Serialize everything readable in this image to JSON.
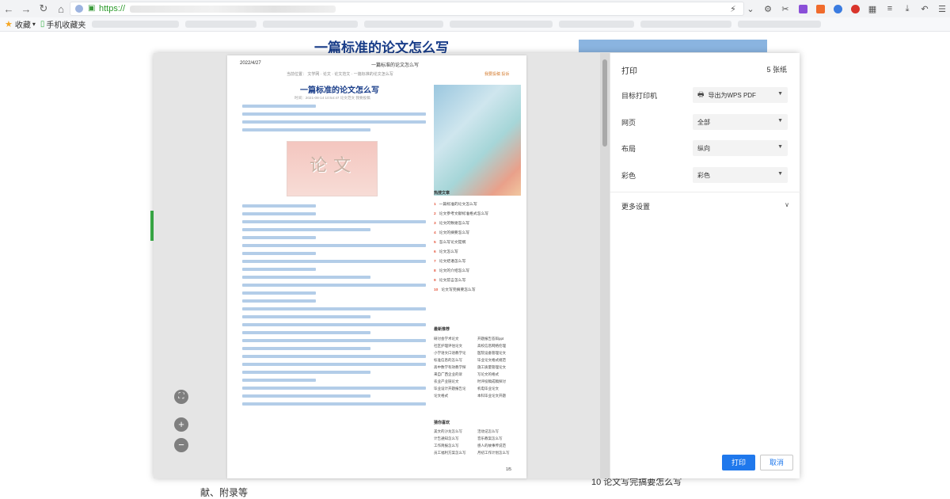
{
  "browser": {
    "url_prefix": "https://",
    "bookmarks": {
      "favorites_label": "收藏",
      "mobile_label": "手机收藏夹"
    },
    "icon_names": [
      "back-icon",
      "forward-icon",
      "reload-icon",
      "home-icon",
      "lightning-icon",
      "chevron-down-icon",
      "scissors-icon",
      "download-icon",
      "undo-icon",
      "menu-icon"
    ]
  },
  "page": {
    "title": "一篇标准的论文怎么写",
    "bottom_text": "献、附录等",
    "bottom_right": "10 论文写完搞要怎么写"
  },
  "preview": {
    "date": "2022/4/27",
    "header_title": "一篇标准的论文怎么写",
    "breadcrumb": "当前位置： 文学网 · 论文 · 论文范文 · 一篇标准的论文怎么写",
    "breadcrumb_right": "我要投稿    投诉",
    "doc_title": "一篇标准的论文怎么写",
    "meta": "时间：2021-08-14 10:54:47    论文范文    我要投稿",
    "image_text": "论文",
    "hot_title": "热搜文章",
    "hot_items": [
      {
        "n": "1",
        "t": "一篇标准的论文怎么写"
      },
      {
        "n": "2",
        "t": "论文参考文献标准格式怎么写"
      },
      {
        "n": "3",
        "t": "论文的致谢怎么写"
      },
      {
        "n": "4",
        "t": "论文的摘要怎么写"
      },
      {
        "n": "5",
        "t": "怎么写论文提纲"
      },
      {
        "n": "6",
        "t": "论文怎么写"
      },
      {
        "n": "7",
        "t": "论文结语怎么写"
      },
      {
        "n": "8",
        "t": "论文的介绍怎么写"
      },
      {
        "n": "9",
        "t": "论文前言怎么写"
      },
      {
        "n": "10",
        "t": "论文写完摘要怎么写"
      }
    ],
    "latest_title": "最新推荐",
    "latest_items": [
      "研讨会学术论文",
      "开题报告答辩ppt",
      "社区护理评估论文",
      "高校信息网络伦理",
      "小学语文口语教学论",
      "医院设备管理论文",
      "标准信息的怎么写",
      "毕业论文格式规范",
      "高中数学有效教学探",
      "施工质量管理论文",
      "来自广西企业的诉",
      "写论文的格式",
      "农业产业链论文",
      "时评投稿成稿探讨",
      "毕业设计开题报告论",
      "机电毕业论文",
      "论文格式",
      "本科毕业论文开题"
    ],
    "reading_title": "猜你喜欢",
    "reading_items": [
      "美文的沙龙怎么写",
      "活动记怎么写",
      "计告通知怎么写",
      "音乐教案怎么写",
      "工作简报怎么写",
      "感人的故事传说范",
      "员工福利方案怎么写",
      "月初工作计划怎么写"
    ],
    "page_num": "1/5"
  },
  "print": {
    "title": "打印",
    "pages_count": "5 张纸",
    "printer_label": "目标打印机",
    "printer_value": "导出为WPS PDF",
    "pages_label": "网页",
    "pages_value": "全部",
    "layout_label": "布局",
    "layout_value": "纵向",
    "color_label": "彩色",
    "color_value": "彩色",
    "more_label": "更多设置",
    "print_button": "打印",
    "cancel_button": "取消",
    "accent_color": "#1f78ec"
  }
}
